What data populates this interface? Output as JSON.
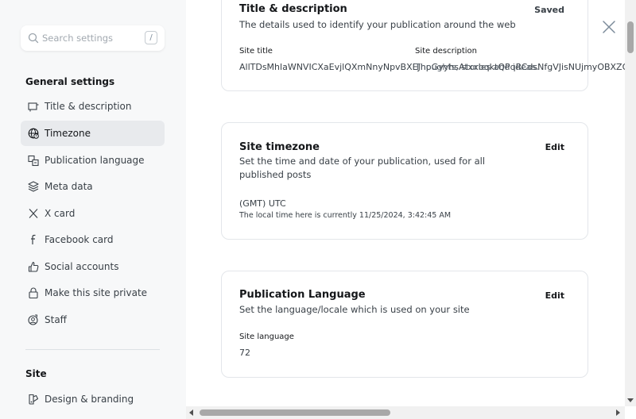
{
  "sidebar": {
    "search_placeholder": "Search settings",
    "search_shortcut": "/",
    "general_heading": "General settings",
    "items": [
      {
        "label": "Title & description",
        "icon": "title-icon"
      },
      {
        "label": "Timezone",
        "icon": "globe-icon"
      },
      {
        "label": "Publication language",
        "icon": "language-icon"
      },
      {
        "label": "Meta data",
        "icon": "layers-icon"
      },
      {
        "label": "X card",
        "icon": "x-icon"
      },
      {
        "label": "Facebook card",
        "icon": "facebook-icon"
      },
      {
        "label": "Social accounts",
        "icon": "thumb-icon"
      },
      {
        "label": "Make this site private",
        "icon": "lock-icon"
      },
      {
        "label": "Staff",
        "icon": "staff-icon"
      }
    ],
    "active_item": "Timezone",
    "site_heading": "Site",
    "site_items": [
      {
        "label": "Design & branding",
        "icon": "brush-icon"
      }
    ]
  },
  "cards": {
    "title_desc": {
      "title": "Title & description",
      "description": "The details used to identify your publication around the web",
      "status": "Saved",
      "site_title_label": "Site title",
      "site_title_value": "AllTDsMhlaWNVICXaEvjlQXmNnyNpvBXEJhpGyyhsAtxxbqktQPqRCdsNfgVJisNUjmyOBXZO",
      "site_description_label": "Site description",
      "site_description_value": "Thoughts, stories and ideas."
    },
    "timezone": {
      "title": "Site timezone",
      "description": "Set the time and date of your publication, used for all published posts",
      "action": "Edit",
      "value": "(GMT) UTC",
      "local_time": "The local time here is currently 11/25/2024, 3:42:45 AM"
    },
    "language": {
      "title": "Publication Language",
      "description": "Set the language/locale which is used on your site",
      "action": "Edit",
      "field_label": "Site language",
      "field_value": "72"
    }
  }
}
